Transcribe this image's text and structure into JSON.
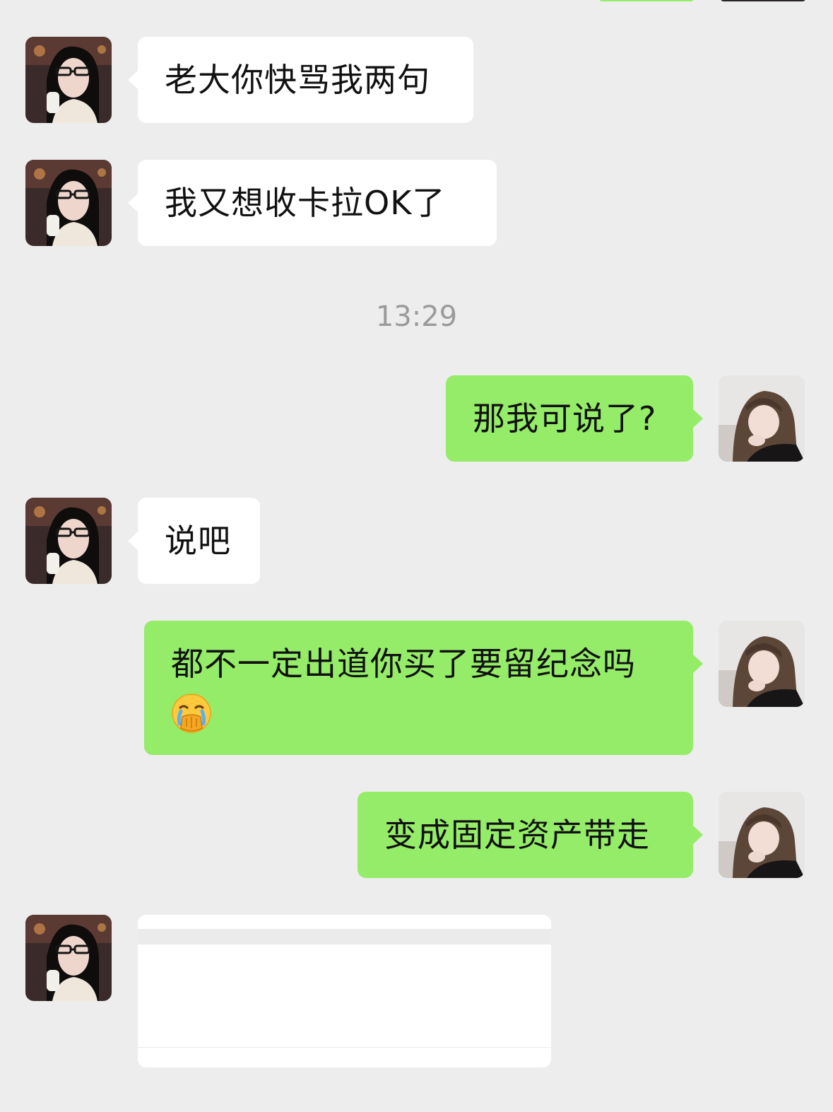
{
  "colors": {
    "background": "#EDEDED",
    "incoming_bubble": "#FFFFFF",
    "outgoing_bubble": "#95EC69",
    "timestamp_text": "#9A9A9A"
  },
  "messages": [
    {
      "side": "left",
      "text": "老大你快骂我两句"
    },
    {
      "side": "left",
      "text": "我又想收卡拉OK了"
    },
    {
      "side": "right",
      "text": "那我可说了?"
    },
    {
      "side": "left",
      "text": "说吧"
    },
    {
      "side": "right",
      "text": "都不一定出道你买了要留纪念吗",
      "emoji": "face-with-hand-over-mouth-crying-icon"
    },
    {
      "side": "right",
      "text": "变成固定资产带走"
    }
  ],
  "timestamp": "13:29",
  "last_message": {
    "side": "left",
    "type": "card"
  }
}
